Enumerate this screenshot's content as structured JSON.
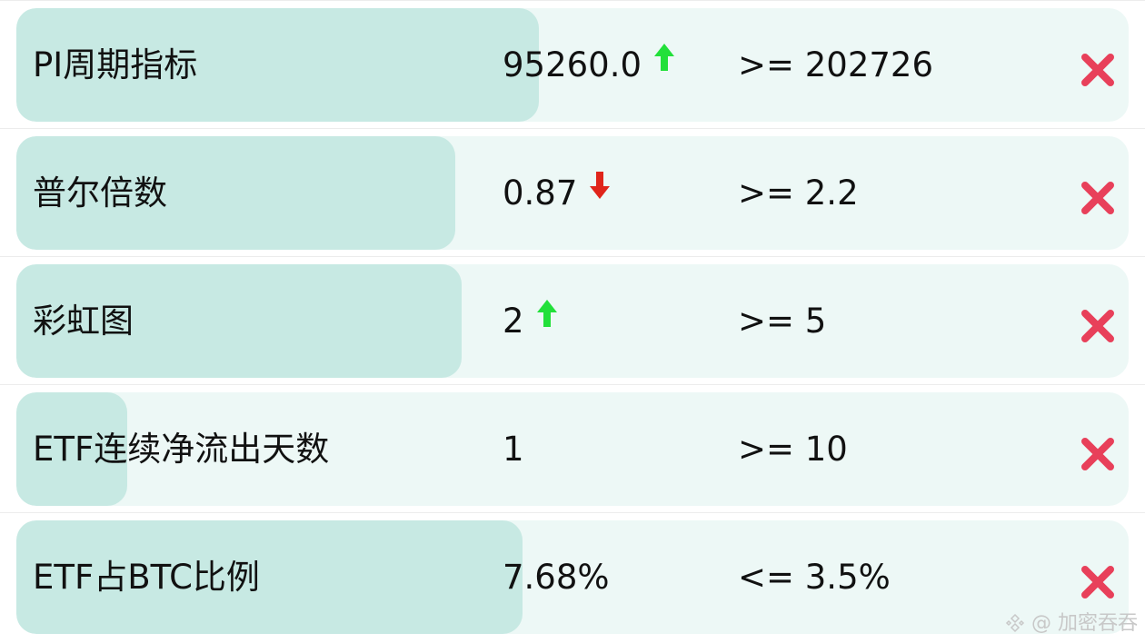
{
  "indicators": [
    {
      "name": "PI周期指标",
      "value": "95260.0",
      "trend": "up",
      "target": ">= 202726",
      "status": "not-met",
      "progress": 0.47
    },
    {
      "name": "普尔倍数",
      "value": "0.87",
      "trend": "down",
      "target": ">= 2.2",
      "status": "not-met",
      "progress": 0.395
    },
    {
      "name": "彩虹图",
      "value": "2",
      "trend": "up",
      "target": ">= 5",
      "status": "not-met",
      "progress": 0.4
    },
    {
      "name": "ETF连续净流出天数",
      "value": "1",
      "trend": "",
      "target": ">= 10",
      "status": "not-met",
      "progress": 0.1
    },
    {
      "name": "ETF占BTC比例",
      "value": "7.68%",
      "trend": "",
      "target": "<= 3.5%",
      "status": "not-met",
      "progress": 0.455
    }
  ],
  "icons": {
    "trend_up": "up-arrow-icon",
    "trend_down": "down-arrow-icon",
    "status_not_met": "cross-icon"
  },
  "colors": {
    "card_bg": "#edf8f6",
    "progress_fill": "#c7e9e3",
    "trend_up": "#22e03a",
    "trend_down": "#e0251b",
    "cross": "#e8405a"
  },
  "watermark": "@ 加密吞吞"
}
